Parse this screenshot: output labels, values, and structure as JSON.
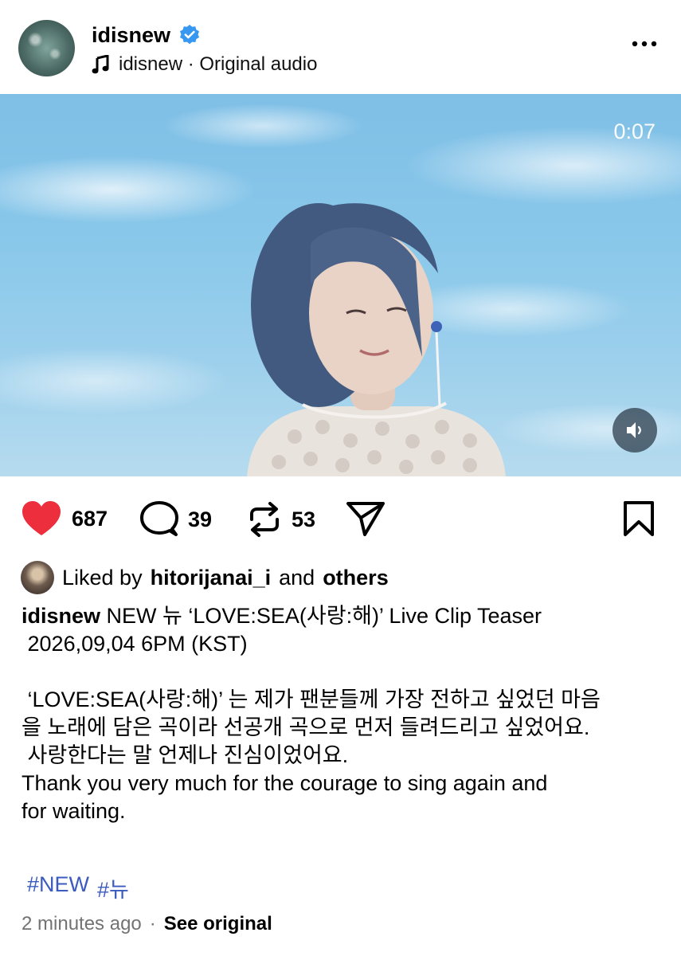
{
  "post": {
    "username": "idisnew",
    "audio_label": "idisnew · Original audio",
    "video_timestamp": "0:07",
    "likes": "687",
    "comments": "39",
    "reposts": "53",
    "liked_by": {
      "prefix": "Liked by",
      "name": "hitorijanai_i",
      "middle": "and",
      "suffix": "others"
    },
    "caption": {
      "username": "idisnew",
      "line1": " NEW 뉴 ‘LOVE:SEA(사랑:해)’ Live Clip Teaser",
      "line2": " 2026,09,04 6PM (KST)",
      "body": "\n ‘LOVE:SEA(사랑:해)’ 는 제가 팬분들께 가장 전하고 싶었던 마음\n을 노래에 담은 곡이라 선공개 곡으로 먼저 들려드리고 싶었어요.\n 사랑한다는 말 언제나 진심이었어요.\nThank you very much for the courage to sing again and\nfor waiting."
    },
    "hashtags": [
      "#NEW",
      "#뉴"
    ],
    "time_ago": "2 minutes ago",
    "separator": "·",
    "see_original": "See original"
  },
  "icons": [
    "verified-badge-icon",
    "music-note-icon",
    "more-options-icon",
    "sound-on-icon",
    "heart-icon",
    "comment-icon",
    "repost-icon",
    "send-icon",
    "bookmark-icon"
  ],
  "colors": {
    "verified": "#3897f0",
    "heart": "#ed2e3d",
    "hashtag": "#3b5bbf",
    "muted": "#737373"
  }
}
